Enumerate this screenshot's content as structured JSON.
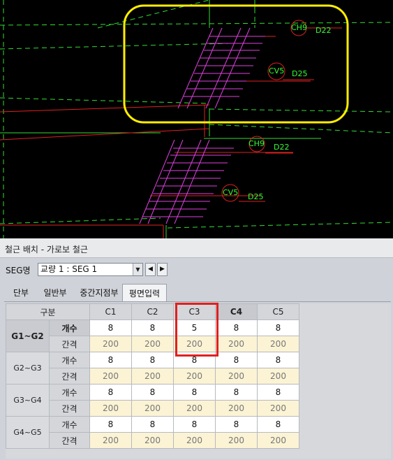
{
  "drawing": {
    "labels": [
      {
        "id": "ch9-top",
        "text": "CH9"
      },
      {
        "id": "d22-top",
        "text": "D22"
      },
      {
        "id": "cv5-top",
        "text": "CV5"
      },
      {
        "id": "d25-top",
        "text": "D25"
      },
      {
        "id": "ch9-bottom",
        "text": "CH9"
      },
      {
        "id": "d22-bottom",
        "text": "D22"
      },
      {
        "id": "cv5-bottom",
        "text": "CV5"
      },
      {
        "id": "d25-bottom",
        "text": "D25"
      }
    ],
    "colors": {
      "background": "#000000",
      "dashed_lines": "#33dd33",
      "rebar": "#e040e0",
      "section_lines": "#e02020",
      "highlight_box": "#ffee00"
    }
  },
  "window": {
    "title": "철근 배치 - 가로보 철근"
  },
  "seg": {
    "label": "SEG명",
    "selected": "교량 1 : SEG 1",
    "prev_icon": "triangle-left",
    "next_icon": "triangle-right"
  },
  "tabs": [
    "단부",
    "일반부",
    "중간지점부",
    "평면입력"
  ],
  "active_tab": "평면입력",
  "grid": {
    "corner": "구분",
    "columns": [
      "C1",
      "C2",
      "C3",
      "C4",
      "C5"
    ],
    "row_labels": {
      "count": "개수",
      "spacing": "간격"
    },
    "groups": [
      {
        "name": "G1~G2",
        "count": [
          "8",
          "8",
          "5",
          "8",
          "8"
        ],
        "spacing": [
          "200",
          "200",
          "200",
          "200",
          "200"
        ]
      },
      {
        "name": "G2~G3",
        "count": [
          "8",
          "8",
          "8",
          "8",
          "8"
        ],
        "spacing": [
          "200",
          "200",
          "200",
          "200",
          "200"
        ]
      },
      {
        "name": "G3~G4",
        "count": [
          "8",
          "8",
          "8",
          "8",
          "8"
        ],
        "spacing": [
          "200",
          "200",
          "200",
          "200",
          "200"
        ]
      },
      {
        "name": "G4~G5",
        "count": [
          "8",
          "8",
          "8",
          "8",
          "8"
        ],
        "spacing": [
          "200",
          "200",
          "200",
          "200",
          "200"
        ]
      }
    ]
  },
  "highlight": {
    "color": "#e02020"
  }
}
